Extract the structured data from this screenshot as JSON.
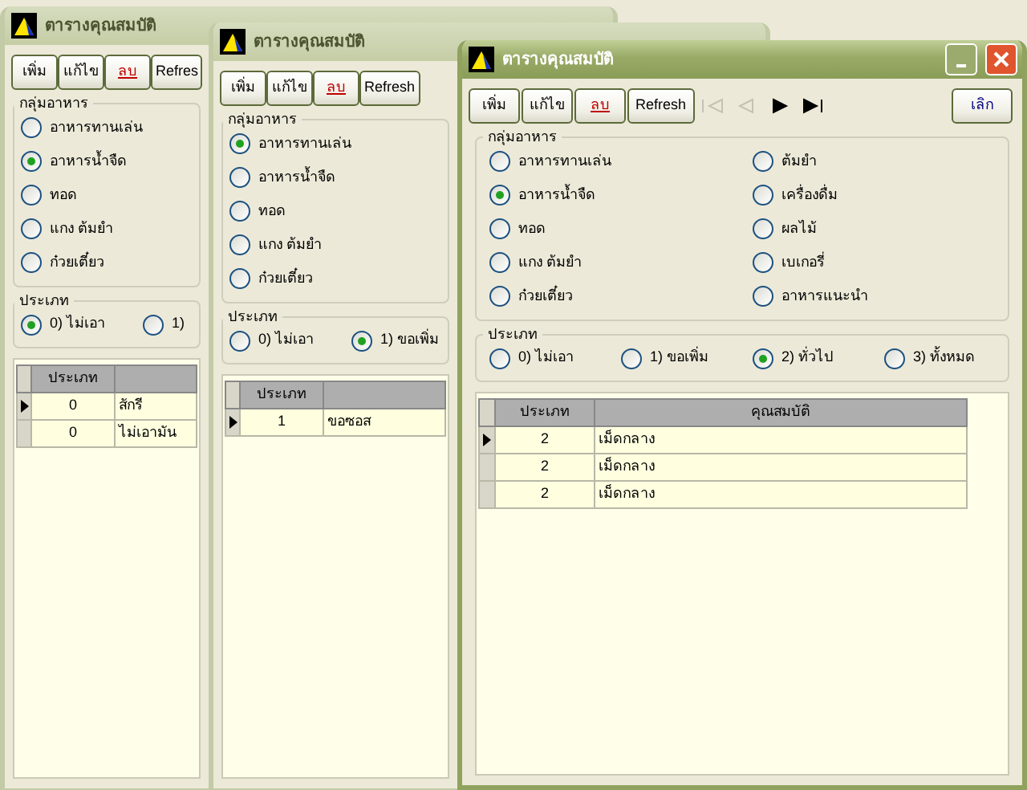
{
  "windows": [
    {
      "title": "ตารางคุณสมบัติ",
      "active": false,
      "buttons": [
        {
          "label": "เพิ่ม",
          "kind": "normal"
        },
        {
          "label": "แก้ไข",
          "kind": "normal"
        },
        {
          "label": "ลบ",
          "kind": "delete"
        },
        {
          "label": "Refres",
          "kind": "normal"
        }
      ],
      "food_group": {
        "label": "กลุ่มอาหาร",
        "options": [
          {
            "label": "อาหารทานเล่น",
            "selected": false
          },
          {
            "label": "อาหารน้ำจืด",
            "selected": true
          },
          {
            "label": "ทอด",
            "selected": false
          },
          {
            "label": "แกง ต้มยำ",
            "selected": false
          },
          {
            "label": "ก๋วยเตี๋ยว",
            "selected": false
          }
        ]
      },
      "type_group": {
        "label": "ประเภท",
        "options": [
          {
            "label": "0) ไม่เอา",
            "selected": true
          },
          {
            "label": "1)",
            "selected": false
          }
        ]
      },
      "grid": {
        "columns": [
          "ประเภท"
        ],
        "rows": [
          {
            "cells": [
              "0",
              "สักรี"
            ],
            "selected": true
          },
          {
            "cells": [
              "0",
              "ไม่เอามัน"
            ],
            "selected": false
          }
        ]
      }
    },
    {
      "title": "ตารางคุณสมบัติ",
      "active": false,
      "buttons": [
        {
          "label": "เพิ่ม",
          "kind": "normal"
        },
        {
          "label": "แก้ไข",
          "kind": "normal"
        },
        {
          "label": "ลบ",
          "kind": "delete"
        },
        {
          "label": "Refresh",
          "kind": "normal"
        }
      ],
      "food_group": {
        "label": "กลุ่มอาหาร",
        "options": [
          {
            "label": "อาหารทานเล่น",
            "selected": true
          },
          {
            "label": "อาหารน้ำจืด",
            "selected": false
          },
          {
            "label": "ทอด",
            "selected": false
          },
          {
            "label": "แกง ต้มยำ",
            "selected": false
          },
          {
            "label": "ก๋วยเตี๋ยว",
            "selected": false
          }
        ]
      },
      "type_group": {
        "label": "ประเภท",
        "options": [
          {
            "label": "0) ไม่เอา",
            "selected": false
          },
          {
            "label": "1) ขอเพิ่ม",
            "selected": true
          }
        ]
      },
      "grid": {
        "columns": [
          "ประเภท"
        ],
        "rows": [
          {
            "cells": [
              "1",
              "ขอซอส"
            ],
            "selected": true
          }
        ]
      }
    },
    {
      "title": "ตารางคุณสมบัติ",
      "active": true,
      "buttons": [
        {
          "label": "เพิ่ม",
          "kind": "normal"
        },
        {
          "label": "แก้ไข",
          "kind": "normal"
        },
        {
          "label": "ลบ",
          "kind": "delete"
        },
        {
          "label": "Refresh",
          "kind": "normal"
        }
      ],
      "nav": [
        {
          "kind": "first",
          "disabled": true
        },
        {
          "kind": "prev",
          "disabled": true
        },
        {
          "kind": "next",
          "disabled": false
        },
        {
          "kind": "last",
          "disabled": false
        }
      ],
      "close_button": {
        "label": "เลิก"
      },
      "food_group": {
        "label": "กลุ่มอาหาร",
        "options": [
          {
            "label": "อาหารทานเล่น",
            "selected": false
          },
          {
            "label": "อาหารน้ำจืด",
            "selected": true
          },
          {
            "label": "ทอด",
            "selected": false
          },
          {
            "label": "แกง ต้มยำ",
            "selected": false
          },
          {
            "label": "ก๋วยเตี๋ยว",
            "selected": false
          },
          {
            "label": "ต้มยำ",
            "selected": false
          },
          {
            "label": "เครื่องดื่ม",
            "selected": false
          },
          {
            "label": "ผลไม้",
            "selected": false
          },
          {
            "label": "เบเกอรี่",
            "selected": false
          },
          {
            "label": "อาหารแนะนำ",
            "selected": false
          }
        ]
      },
      "type_group": {
        "label": "ประเภท",
        "options": [
          {
            "label": "0) ไม่เอา",
            "selected": false
          },
          {
            "label": "1) ขอเพิ่ม",
            "selected": false
          },
          {
            "label": "2) ทั่วไป",
            "selected": true
          },
          {
            "label": "3) ทั้งหมด",
            "selected": false
          }
        ]
      },
      "grid": {
        "columns": [
          "ประเภท",
          "คุณสมบัติ"
        ],
        "rows": [
          {
            "cells": [
              "2",
              "เม็ดกลาง"
            ],
            "selected": true
          },
          {
            "cells": [
              "2",
              "เม็ดกลาง"
            ],
            "selected": false
          },
          {
            "cells": [
              "2",
              "เม็ดกลาง"
            ],
            "selected": false
          }
        ]
      }
    }
  ]
}
